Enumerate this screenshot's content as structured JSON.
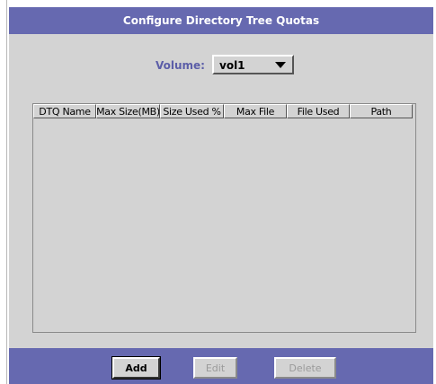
{
  "dialog": {
    "title": "Configure Directory Tree Quotas"
  },
  "volume": {
    "label": "Volume:",
    "selected": "vol1"
  },
  "table": {
    "columns": [
      "DTQ Name",
      "Max Size(MB)",
      "Size Used %",
      "Max File",
      "File Used",
      "Path"
    ],
    "rows": []
  },
  "buttons": {
    "add": "Add",
    "edit": "Edit",
    "delete": "Delete"
  },
  "colors": {
    "bar": "#6669b0",
    "panel": "#d3d3d3",
    "label": "#5c5ea8",
    "disabled_text": "#9a9a9a"
  }
}
